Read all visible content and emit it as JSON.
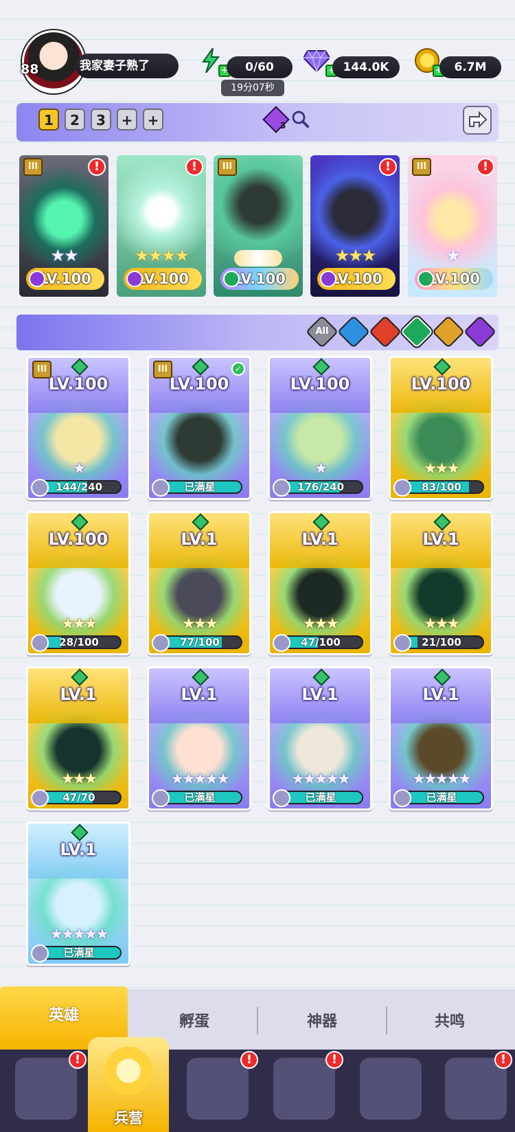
{
  "player": {
    "level": "88",
    "name": "我家妻子熟了"
  },
  "resources": {
    "energy": "0/60",
    "energy_timer": "19分07秒",
    "gems": "144.0K",
    "gold": "6.7M"
  },
  "team": {
    "tabs": [
      "1",
      "2",
      "3",
      "+",
      "+"
    ],
    "active_tab": "1",
    "team_count": "3"
  },
  "lineup": [
    {
      "level": "LV.100",
      "element": "dark",
      "stars": "★★",
      "has_alert": true,
      "roman": "III"
    },
    {
      "level": "LV.100",
      "element": "dark",
      "stars": "★★★★",
      "has_alert": true,
      "roman": ""
    },
    {
      "level": "LV.100",
      "element": "nature",
      "stars": "",
      "has_alert": false,
      "roman": "III"
    },
    {
      "level": "LV.100",
      "element": "dark",
      "stars": "★★★",
      "has_alert": true,
      "roman": ""
    },
    {
      "level": "LV.100",
      "element": "nature",
      "stars": "★",
      "has_alert": true,
      "roman": "III"
    }
  ],
  "filters": [
    {
      "name": "All",
      "label": "All",
      "color": "#8c8c96"
    },
    {
      "name": "water",
      "label": "",
      "color": "#2f8fe0"
    },
    {
      "name": "fire",
      "label": "",
      "color": "#e0402a"
    },
    {
      "name": "nature",
      "label": "",
      "color": "#1ea85a"
    },
    {
      "name": "light",
      "label": "",
      "color": "#e2a12a"
    },
    {
      "name": "dark",
      "label": "",
      "color": "#8a3ad6"
    }
  ],
  "roster": [
    {
      "level": "LV.100",
      "progress": "144/240",
      "fill": 0.6,
      "stars": "★",
      "rarity": "purple",
      "check": false,
      "roman": "III"
    },
    {
      "level": "LV.100",
      "progress": "已满星",
      "fill": 1,
      "stars": "",
      "rarity": "purple",
      "check": true,
      "roman": "III"
    },
    {
      "level": "LV.100",
      "progress": "176/240",
      "fill": 0.73,
      "stars": "★",
      "rarity": "purple",
      "check": false,
      "roman": ""
    },
    {
      "level": "LV.100",
      "progress": "83/100",
      "fill": 0.83,
      "stars": "★★★",
      "rarity": "gold",
      "check": false,
      "roman": ""
    },
    {
      "level": "LV.100",
      "progress": "28/100",
      "fill": 0.28,
      "stars": "★★★",
      "rarity": "gold",
      "check": false,
      "roman": ""
    },
    {
      "level": "LV.1",
      "progress": "77/100",
      "fill": 0.77,
      "stars": "★★★",
      "rarity": "gold",
      "check": false,
      "roman": ""
    },
    {
      "level": "LV.1",
      "progress": "47/100",
      "fill": 0.47,
      "stars": "★★★",
      "rarity": "gold",
      "check": false,
      "roman": ""
    },
    {
      "level": "LV.1",
      "progress": "21/100",
      "fill": 0.21,
      "stars": "★★★",
      "rarity": "gold",
      "check": false,
      "roman": ""
    },
    {
      "level": "LV.1",
      "progress": "47/70",
      "fill": 0.67,
      "stars": "★★★",
      "rarity": "gold",
      "check": false,
      "roman": ""
    },
    {
      "level": "LV.1",
      "progress": "已满星",
      "fill": 1,
      "stars": "★★★★★",
      "rarity": "purple",
      "check": false,
      "roman": ""
    },
    {
      "level": "LV.1",
      "progress": "已满星",
      "fill": 1,
      "stars": "★★★★★",
      "rarity": "purple",
      "check": false,
      "roman": ""
    },
    {
      "level": "LV.1",
      "progress": "已满星",
      "fill": 1,
      "stars": "★★★★★",
      "rarity": "purple",
      "check": false,
      "roman": ""
    },
    {
      "level": "LV.1",
      "progress": "已满星",
      "fill": 1,
      "stars": "★★★★★",
      "rarity": "blue",
      "check": false,
      "roman": ""
    }
  ],
  "sub_tabs": [
    "英雄",
    "孵蛋",
    "神器",
    "共鸣"
  ],
  "active_sub_tab": "英雄",
  "bottom_nav": [
    {
      "name": "cards",
      "label": "",
      "alert": true
    },
    {
      "name": "barracks",
      "label": "兵营",
      "alert": false,
      "active": true
    },
    {
      "name": "book",
      "label": "",
      "alert": true
    },
    {
      "name": "castle",
      "label": "",
      "alert": true
    },
    {
      "name": "guild",
      "label": "",
      "alert": false
    },
    {
      "name": "scroll",
      "label": "",
      "alert": true
    }
  ]
}
